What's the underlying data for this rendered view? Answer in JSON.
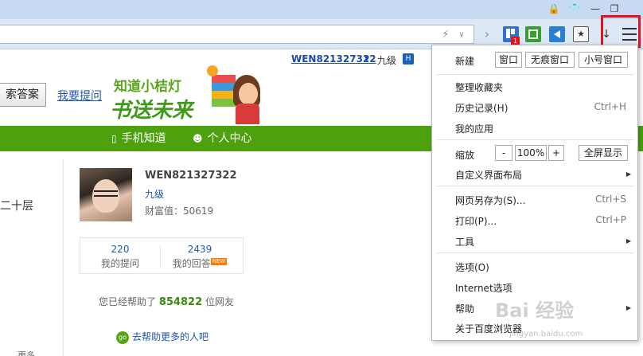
{
  "browser": {
    "toolbar_badge": "1",
    "titlebar_icons": [
      "lock-icon",
      "shirt-icon",
      "minimize-icon",
      "restore-icon"
    ],
    "toolbar_icons": [
      "lightning-icon",
      "dropdown-icon",
      "forward-icon",
      "extension-icon",
      "screenshot-icon",
      "sound-icon",
      "bookmark-star-icon",
      "download-icon",
      "menu-icon"
    ],
    "accent_color": "#e6111b"
  },
  "page": {
    "username": "WEN821327322",
    "level": "九级",
    "search_button": "索答案",
    "ask_link": "我要提问",
    "logo": {
      "line1": "知道小桔灯",
      "line2": "书送未来"
    },
    "nav": {
      "mobile": "手机知道",
      "personal": "个人中心"
    },
    "left_col_text": "二十层",
    "profile": {
      "name": "WEN821327322",
      "level": "九级",
      "wealth": "财富值：50619"
    },
    "stats": {
      "questions_num": "220",
      "questions_label": "我的提问",
      "answers_num": "2439",
      "answers_label": "我的回答",
      "new_badge": "NEW"
    },
    "helped": {
      "prefix": "您已经帮助了",
      "count": "854822",
      "suffix": "位网友"
    },
    "help_more": "去帮助更多的人吧",
    "go_badge": "go",
    "more": "更多",
    "green_color": "#4da10d"
  },
  "menu": {
    "new_label": "新建",
    "new_window": "窗口",
    "incognito_window": "无痕窗口",
    "small_window": "小号窗口",
    "organize_favorites": "整理收藏夹",
    "history": "历史记录(H)",
    "history_shortcut": "Ctrl+H",
    "my_apps": "我的应用",
    "zoom_label": "缩放",
    "zoom_minus": "-",
    "zoom_value": "100%",
    "zoom_plus": "+",
    "fullscreen": "全屏显示",
    "custom_layout": "自定义界面布局",
    "save_as": "网页另存为(S)...",
    "save_as_shortcut": "Ctrl+S",
    "print": "打印(P)...",
    "print_shortcut": "Ctrl+P",
    "tools": "工具",
    "options": "选项(O)",
    "internet_options": "Internet选项",
    "help": "帮助",
    "about": "关于百度浏览器"
  },
  "watermark": {
    "text": "Bai 经验",
    "sub": "jingyan.baidu.com"
  }
}
